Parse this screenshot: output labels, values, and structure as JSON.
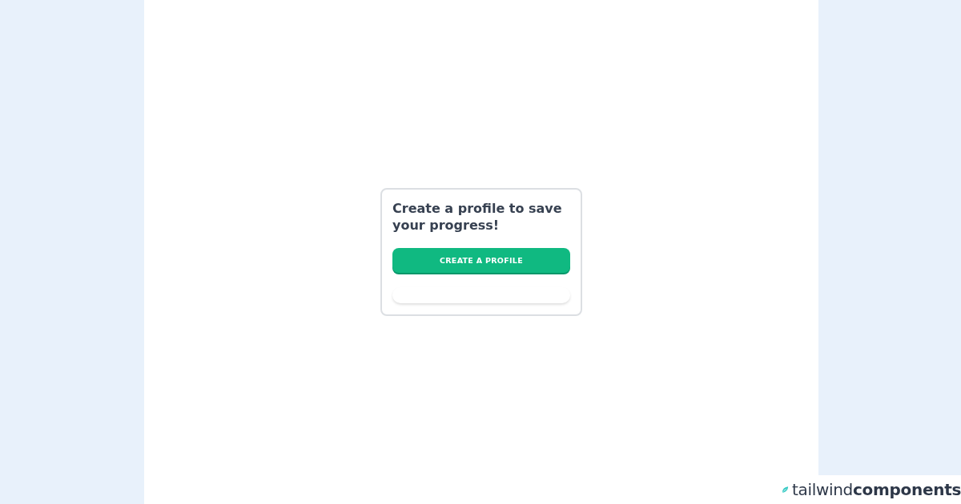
{
  "card": {
    "title": "Create a profile to save your progress!",
    "button": "CREATE A PROFILE"
  },
  "brand": {
    "logo": "tailwind**components**"
  }
}
